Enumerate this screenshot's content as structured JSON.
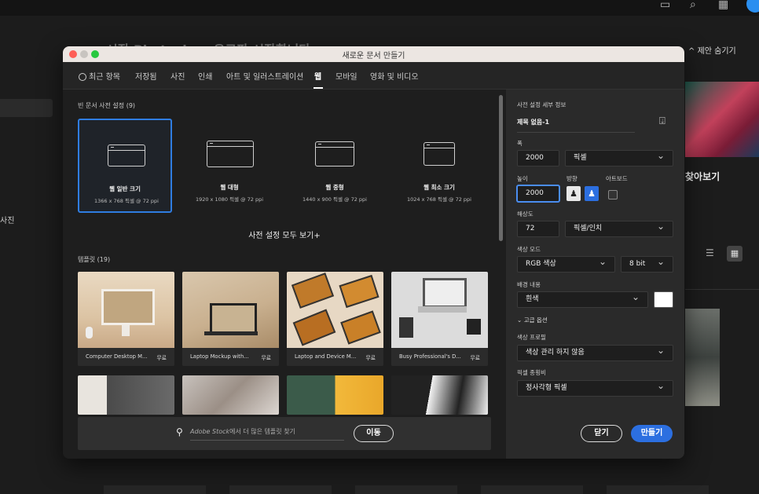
{
  "background": {
    "heading": "시작 Photoshop 유료판 시작합니다",
    "hide_suggestions": "제안 숨기기",
    "explore": "찾아보기",
    "sidebar_label": "사진"
  },
  "dialog": {
    "title": "새로운 문서 만들기",
    "tabs": [
      {
        "label": "최근 항목"
      },
      {
        "label": "저장됨"
      },
      {
        "label": "사진"
      },
      {
        "label": "인쇄"
      },
      {
        "label": "아트 및 일러스트레이션"
      },
      {
        "label": "웹"
      },
      {
        "label": "모바일"
      },
      {
        "label": "영화 및 비디오"
      }
    ],
    "active_tab": "웹",
    "blank_presets_label": "빈 문서 사전 설정",
    "blank_presets_count": "(9)",
    "presets": [
      {
        "name": "웹 일반 크기",
        "size": "1366 x 768 픽셀 @ 72 ppi"
      },
      {
        "name": "웹 대형",
        "size": "1920 x 1080 픽셀 @ 72 ppi"
      },
      {
        "name": "웹 중형",
        "size": "1440 x 900 픽셀 @ 72 ppi"
      },
      {
        "name": "웹 최소 크기",
        "size": "1024 x 768 픽셀 @ 72 ppi"
      }
    ],
    "view_all": "사전 설정 모두 보기+",
    "templates_label": "템플릿",
    "templates_count": "(19)",
    "templates": [
      {
        "name": "Computer Desktop M...",
        "price": "무료"
      },
      {
        "name": "Laptop Mockup with...",
        "price": "무료"
      },
      {
        "name": "Laptop and Device M...",
        "price": "무료"
      },
      {
        "name": "Busy Professional's D...",
        "price": "무료"
      }
    ],
    "stock_brand": "Adobe Stock",
    "stock_text": "에서 더 많은 템플릿 찾기",
    "go_button": "이동",
    "details": {
      "section_title": "사전 설정 세부 정보",
      "doc_name": "제목 없음-1",
      "width_label": "폭",
      "width_value": "2000",
      "width_unit": "픽셀",
      "height_label": "높이",
      "height_value": "2000",
      "orientation_label": "방향",
      "artboard_label": "아트보드",
      "resolution_label": "해상도",
      "resolution_value": "72",
      "resolution_unit": "픽셀/인치",
      "color_mode_label": "색상 모드",
      "color_mode_value": "RGB 색상",
      "bit_depth": "8 bit",
      "background_label": "배경 내용",
      "background_value": "흰색",
      "advanced_label": "고급 옵션",
      "color_profile_label": "색상 프로필",
      "color_profile_value": "색상 관리 하지 않음",
      "pixel_aspect_label": "픽셀 종횡비",
      "pixel_aspect_value": "정사각형 픽셀"
    },
    "close_button": "닫기",
    "create_button": "만들기"
  },
  "colors": {
    "accent": "#2c6fe0",
    "selection": "#2f7de1"
  }
}
